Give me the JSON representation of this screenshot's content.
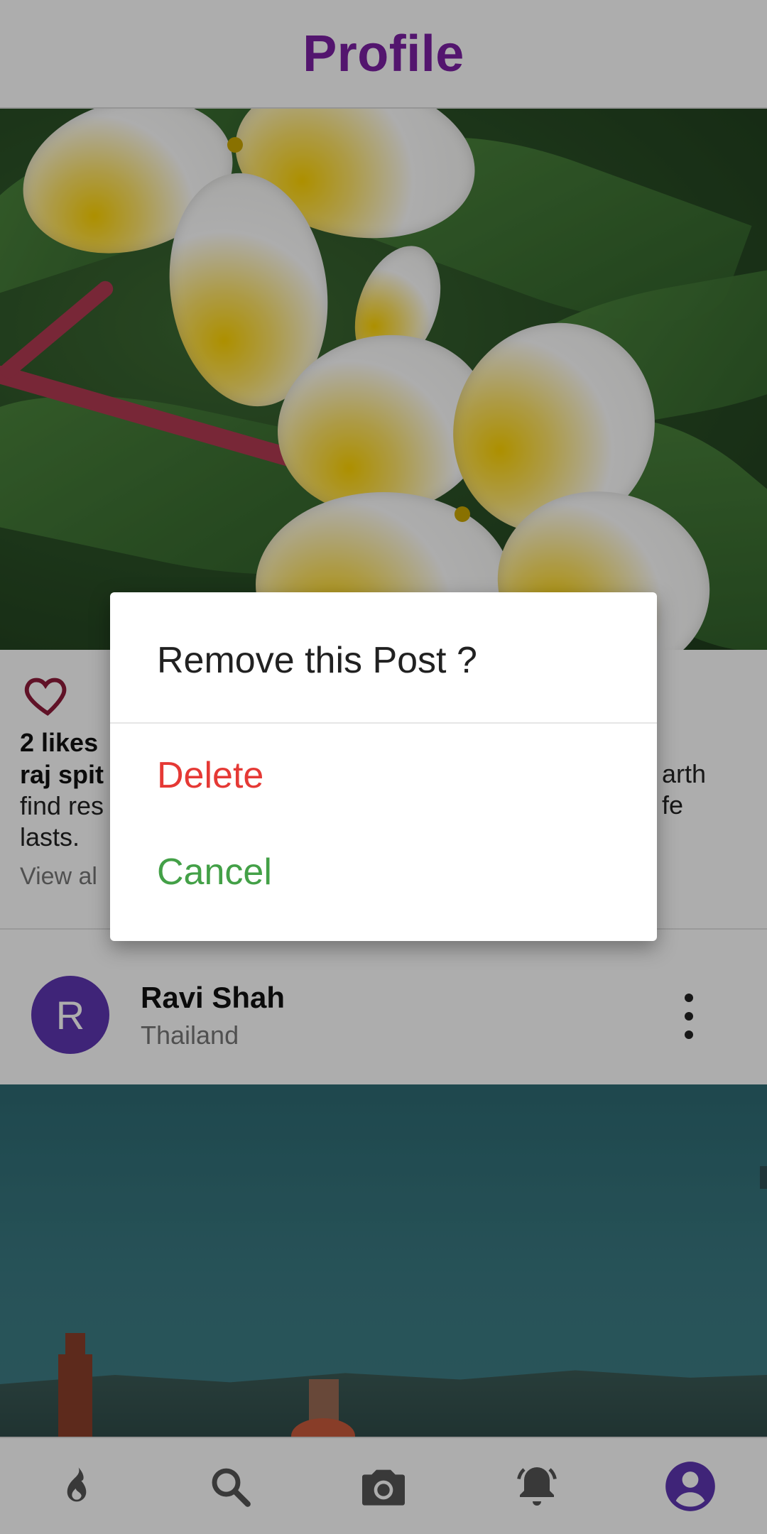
{
  "header": {
    "title": "Profile"
  },
  "post1": {
    "likes": "2 likes",
    "author": "raj spit",
    "caption_text": " find res... arth ... fe lasts.",
    "caption_visible_left": "find res",
    "caption_visible_right_1": "arth",
    "caption_visible_right_2": "fe",
    "caption_last_line": "lasts.",
    "view_all": "View al"
  },
  "post2": {
    "avatar_letter": "R",
    "user_name": "Ravi Shah",
    "location": "Thailand"
  },
  "dialog": {
    "title": "Remove this Post ?",
    "delete_label": "Delete",
    "cancel_label": "Cancel"
  },
  "colors": {
    "brand": "#7b1fa2",
    "avatar": "#5e35b1",
    "delete": "#e53935",
    "cancel": "#43a047",
    "heart": "#8e1b3a"
  },
  "nav": {
    "items": [
      {
        "icon": "flame-icon"
      },
      {
        "icon": "search-icon"
      },
      {
        "icon": "camera-icon"
      },
      {
        "icon": "bell-icon"
      },
      {
        "icon": "account-icon"
      }
    ]
  }
}
